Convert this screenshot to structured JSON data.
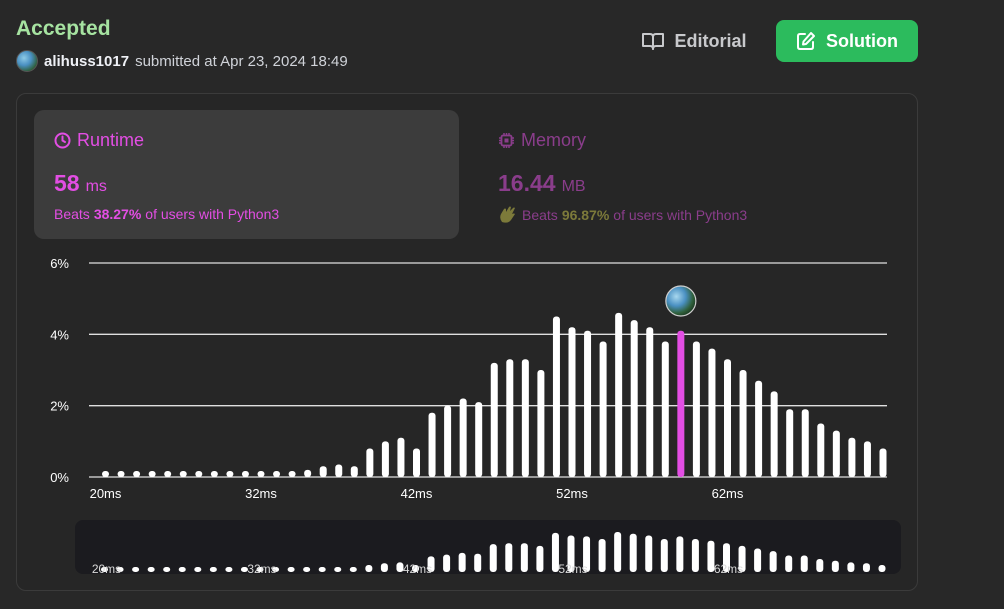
{
  "header": {
    "status": "Accepted",
    "username": "alihuss1017",
    "submitted_text": "submitted at Apr 23, 2024 18:49"
  },
  "buttons": {
    "editorial_label": "Editorial",
    "solution_label": "Solution"
  },
  "runtime": {
    "label": "Runtime",
    "value": "58",
    "unit": "ms",
    "beats_prefix": "Beats",
    "beats_pct": "38.27%",
    "beats_suffix": "of users with Python3"
  },
  "memory": {
    "label": "Memory",
    "value": "16.44",
    "unit": "MB",
    "beats_prefix": "Beats",
    "beats_pct": "96.87%",
    "beats_suffix": "of users with Python3"
  },
  "colors": {
    "accepted": "#a6e3a1",
    "runtime_accent": "#e34ee4",
    "solution_button": "#2cbb5d",
    "bar": "#ffffff",
    "highlight_bar": "#e34ee4"
  },
  "chart_data": {
    "type": "bar",
    "title": "",
    "xlabel": "",
    "ylabel": "",
    "ylim": [
      0,
      6
    ],
    "y_ticks": [
      "0%",
      "2%",
      "4%",
      "6%"
    ],
    "x_ticks": [
      "20ms",
      "32ms",
      "42ms",
      "52ms",
      "62ms"
    ],
    "unit": "%",
    "highlight_index": 37,
    "highlight_label": "58ms",
    "values": [
      0.08,
      0.1,
      0.1,
      0.08,
      0.1,
      0.08,
      0.1,
      0.08,
      0.1,
      0.1,
      0.08,
      0.1,
      0.1,
      0.2,
      0.3,
      0.35,
      0.3,
      0.8,
      1.0,
      1.1,
      0.8,
      1.8,
      2.0,
      2.2,
      2.1,
      3.2,
      3.3,
      3.3,
      3.0,
      4.5,
      4.2,
      4.1,
      3.8,
      4.6,
      4.4,
      4.2,
      3.8,
      4.1,
      3.8,
      3.6,
      3.3,
      3.0,
      2.7,
      2.4,
      1.9,
      1.9,
      1.5,
      1.3,
      1.1,
      1.0,
      0.8
    ],
    "minimap_x_ticks": [
      "20ms",
      "32ms",
      "42ms",
      "52ms",
      "62ms"
    ]
  }
}
